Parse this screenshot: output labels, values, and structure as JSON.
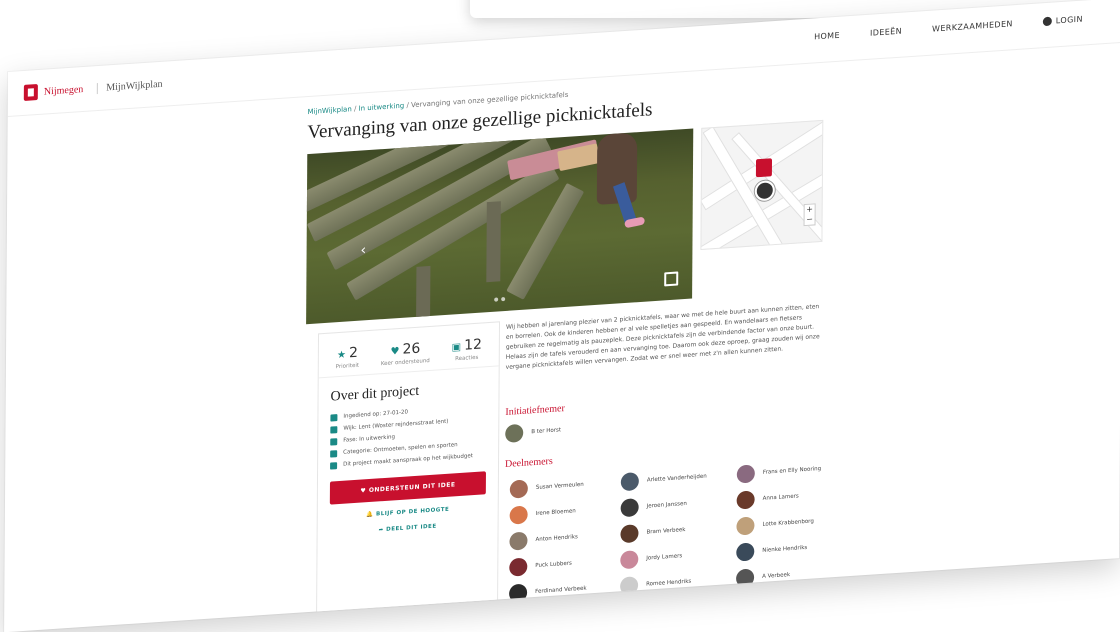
{
  "nav": {
    "home": "HOME",
    "ideas": "IDEEËN",
    "work": "WERKZAAMHEDEN",
    "login": "LOGIN"
  },
  "logo": {
    "brand": "Nijmegen",
    "site": "MijnWijkplan"
  },
  "breadcrumb": {
    "root": "MijnWijkplan",
    "section": "In uitwerking",
    "current": "Vervanging van onze gezellige picknicktafels"
  },
  "page": {
    "title": "Vervanging van onze gezellige picknicktafels"
  },
  "stats": [
    {
      "icon": "star-icon",
      "value": "2",
      "label": "Prioriteit"
    },
    {
      "icon": "heart-icon",
      "value": "26",
      "label": "Keer ondersteund"
    },
    {
      "icon": "comment-icon",
      "value": "12",
      "label": "Reacties"
    }
  ],
  "about": {
    "title": "Over dit project",
    "items": [
      {
        "icon": "calendar-icon",
        "text": "Ingediend op: 27-01-20"
      },
      {
        "icon": "location-icon",
        "text": "Wijk: Lent (Woster rejndersstraat lent)"
      },
      {
        "icon": "pencil-icon",
        "text": "Fase: In uitwerking"
      },
      {
        "icon": "category-icon",
        "text": "Categorie: Ontmoeten, spelen en sporten"
      },
      {
        "icon": "euro-icon",
        "text": "Dit project maakt aanspraak op het wijkbudget"
      }
    ],
    "support_label": "ONDERSTEUN DIT IDEE",
    "follow_label": "BLIJF OP DE HOOGTE",
    "share_label": "DEEL DIT IDEE"
  },
  "description": "Wij hebben al jarenlang plezier van 2 picknicktafels, waar we met de hele buurt aan kunnen zitten, eten en borrelen. Ook de kinderen hebben er al vele spelletjes aan gespeeld. En wandelaars en fietsers gebruiken ze regelmatig als pauzeplek. Deze picknicktafels zijn de verbindende factor van onze buurt. Helaas zijn de tafels verouderd en aan vervanging toe. Daarom ook deze oproep, graag zouden wij onze vergane picknicktafels willen vervangen. Zodat we er snel weer met z'n allen kunnen zitten.",
  "initiator": {
    "title": "Initiatiefnemer",
    "name": "B ter Horst"
  },
  "participants": {
    "title": "Deelnemers",
    "people": [
      "Susan Vermeulen",
      "Irene Bloemen",
      "Anton Hendriks",
      "Puck Lubbers",
      "Ferdinand Verbeek",
      "Arlette Vanderheijden",
      "Jeroen Janssen",
      "Bram Verbeek",
      "Jordy Lamers",
      "Romee Hendriks",
      "Frans en Elly Nooring",
      "Anna Lamers",
      "Lotte Krabbenborg",
      "Nienke Hendriks",
      "A Verbeek"
    ]
  },
  "colors": {
    "accent": "#c8102e",
    "teal": "#1a8a86"
  }
}
